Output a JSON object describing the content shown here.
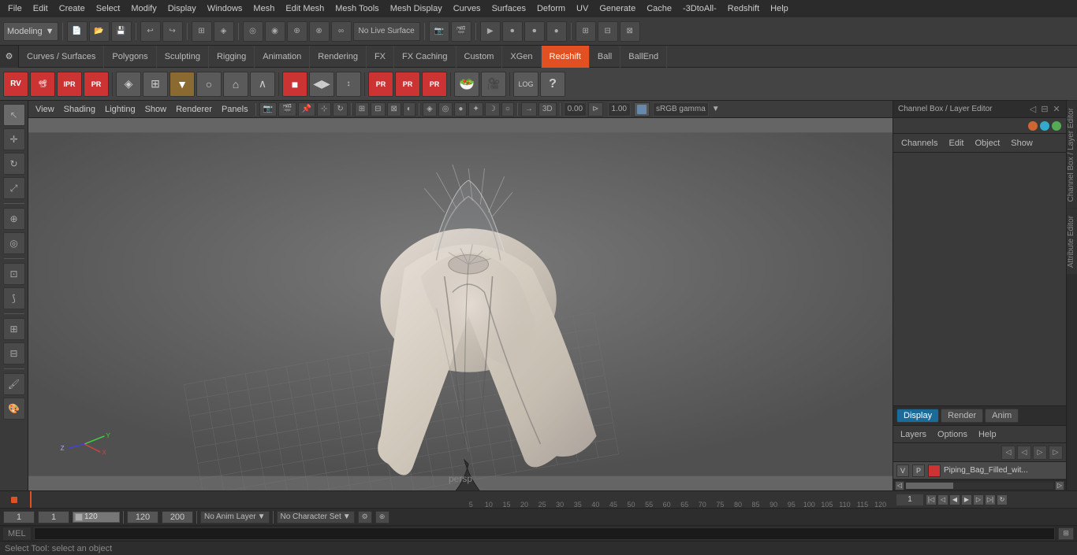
{
  "menubar": {
    "items": [
      "File",
      "Edit",
      "Create",
      "Select",
      "Modify",
      "Display",
      "Windows",
      "Mesh",
      "Edit Mesh",
      "Mesh Tools",
      "Mesh Display",
      "Curves",
      "Surfaces",
      "Deform",
      "UV",
      "Generate",
      "Cache",
      "-3DtoAll-",
      "Redshift",
      "Help"
    ]
  },
  "toolbar1": {
    "mode": "Modeling",
    "mode_arrow": "▼"
  },
  "shelf_tabs": {
    "items": [
      "Curves / Surfaces",
      "Polygons",
      "Sculpting",
      "Rigging",
      "Animation",
      "Rendering",
      "FX",
      "FX Caching",
      "Custom",
      "XGen",
      "Redshift",
      "Ball",
      "BallEnd"
    ],
    "active": "Redshift"
  },
  "viewport": {
    "menus": [
      "View",
      "Shading",
      "Lighting",
      "Show",
      "Renderer",
      "Panels"
    ],
    "label": "persp",
    "gamma": "sRGB gamma",
    "value1": "0.00",
    "value2": "1.00"
  },
  "channel_box": {
    "title": "Channel Box / Layer Editor",
    "tabs": [
      "Channels",
      "Edit",
      "Object",
      "Show"
    ],
    "layer_tabs": [
      "Display",
      "Render",
      "Anim"
    ],
    "active_layer_tab": "Display",
    "layer_menus": [
      "Layers",
      "Options",
      "Help"
    ],
    "layer": {
      "v": "V",
      "p": "P",
      "name": "Piping_Bag_Filled_wit..."
    }
  },
  "timeline": {
    "ticks": [
      5,
      10,
      15,
      20,
      25,
      30,
      35,
      40,
      45,
      50,
      55,
      60,
      65,
      70,
      75,
      80,
      85,
      90,
      95,
      100,
      105,
      110,
      115,
      120
    ]
  },
  "status_bar": {
    "frame_start": "1",
    "frame_current": "1",
    "frame_value": "1",
    "range_start": "1",
    "range_end": "120",
    "frame_end_value": "120",
    "max_frame": "200",
    "no_anim_layer": "No Anim Layer",
    "no_char_set": "No Character Set"
  },
  "command_line": {
    "label": "MEL",
    "placeholder": ""
  },
  "info_bar": {
    "text": "Select Tool: select an object"
  },
  "side_tabs": [
    "Channel Box / Layer Editor",
    "Attribute Editor"
  ]
}
